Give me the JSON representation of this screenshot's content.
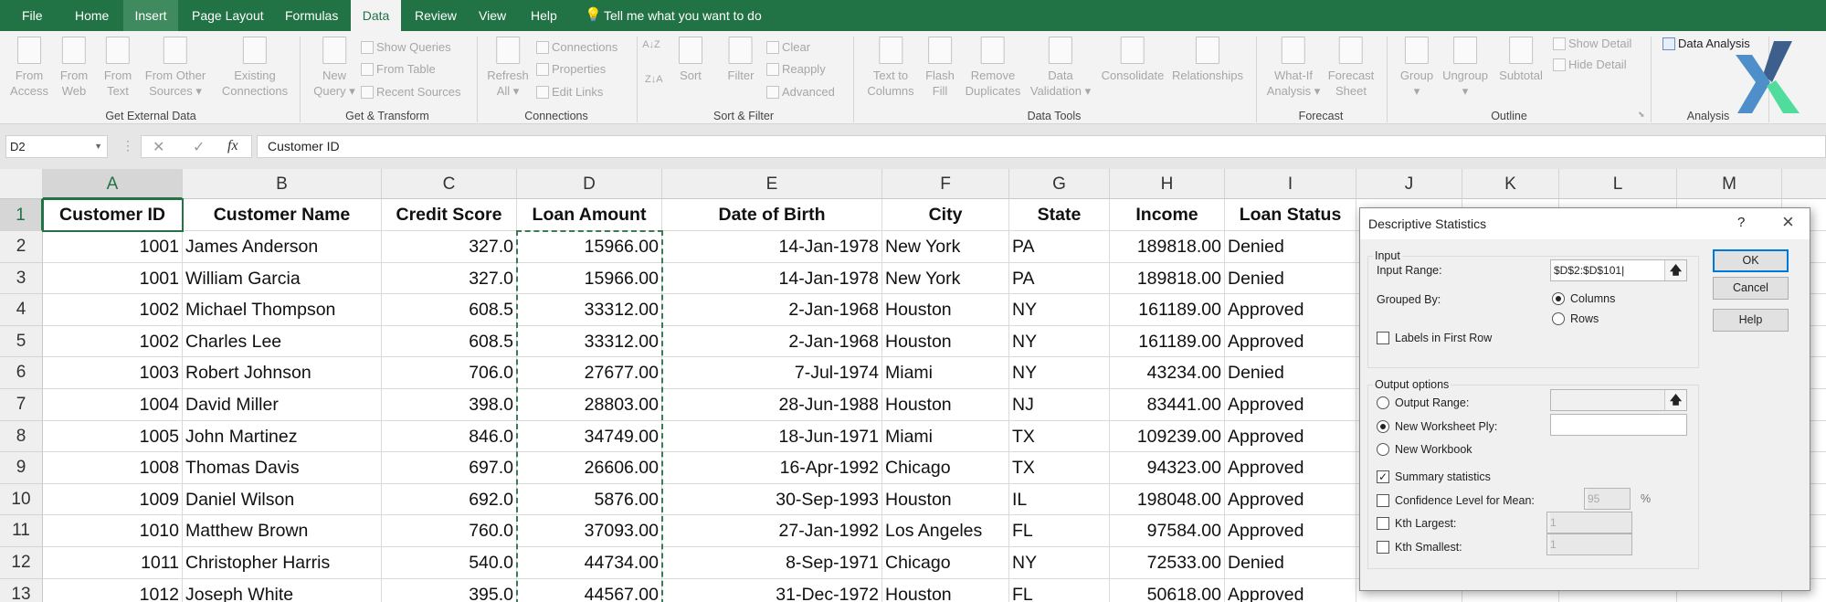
{
  "tabs": [
    {
      "label": "File"
    },
    {
      "label": "Home"
    },
    {
      "label": "Insert"
    },
    {
      "label": "Page Layout"
    },
    {
      "label": "Formulas"
    },
    {
      "label": "Data"
    },
    {
      "label": "Review"
    },
    {
      "label": "View"
    },
    {
      "label": "Help"
    }
  ],
  "tell_me": "Tell me what you want to do",
  "active_tab": "Data",
  "ribbon": {
    "large": [
      {
        "lines": [
          "From",
          "Access"
        ],
        "icon": "access-icon"
      },
      {
        "lines": [
          "From",
          "Web"
        ],
        "icon": "web-icon"
      },
      {
        "lines": [
          "From",
          "Text"
        ],
        "icon": "text-file-icon"
      },
      {
        "lines": [
          "From Other",
          "Sources ▾"
        ],
        "icon": "other-sources-icon"
      },
      {
        "lines": [
          "Existing",
          "Connections"
        ],
        "icon": "existing-connections-icon"
      },
      {
        "lines": [
          "New",
          "Query ▾"
        ],
        "icon": "new-query-icon"
      },
      {
        "lines": [
          "Refresh",
          "All ▾"
        ],
        "icon": "refresh-icon"
      },
      {
        "lines": [
          "Sort",
          ""
        ],
        "icon": "sort-icon"
      },
      {
        "lines": [
          "Filter",
          ""
        ],
        "icon": "filter-icon"
      },
      {
        "lines": [
          "Text to",
          "Columns"
        ],
        "icon": "text-to-columns-icon"
      },
      {
        "lines": [
          "Flash",
          "Fill"
        ],
        "icon": "flash-fill-icon"
      },
      {
        "lines": [
          "Remove",
          "Duplicates"
        ],
        "icon": "remove-duplicates-icon"
      },
      {
        "lines": [
          "Data",
          "Validation ▾"
        ],
        "icon": "data-validation-icon"
      },
      {
        "lines": [
          "Consolidate",
          ""
        ],
        "icon": "consolidate-icon"
      },
      {
        "lines": [
          "Relationships",
          ""
        ],
        "icon": "relationships-icon"
      },
      {
        "lines": [
          "What-If",
          "Analysis ▾"
        ],
        "icon": "what-if-icon"
      },
      {
        "lines": [
          "Forecast",
          "Sheet"
        ],
        "icon": "forecast-sheet-icon"
      },
      {
        "lines": [
          "Group",
          "▾"
        ],
        "icon": "group-icon"
      },
      {
        "lines": [
          "Ungroup",
          "▾"
        ],
        "icon": "ungroup-icon"
      },
      {
        "lines": [
          "Subtotal",
          ""
        ],
        "icon": "subtotal-icon"
      }
    ],
    "small": [
      {
        "label": "Show Queries",
        "icon": "show-queries-icon"
      },
      {
        "label": "From Table",
        "icon": "from-table-icon"
      },
      {
        "label": "Recent Sources",
        "icon": "recent-sources-icon"
      },
      {
        "label": "Connections",
        "icon": "connections-icon"
      },
      {
        "label": "Properties",
        "icon": "properties-icon"
      },
      {
        "label": "Edit Links",
        "icon": "edit-links-icon"
      },
      {
        "label": "Clear",
        "icon": "clear-filter-icon"
      },
      {
        "label": "Reapply",
        "icon": "reapply-icon"
      },
      {
        "label": "Advanced",
        "icon": "advanced-filter-icon"
      },
      {
        "label": "Show Detail",
        "icon": "show-detail-icon"
      },
      {
        "label": "Hide Detail",
        "icon": "hide-detail-icon"
      },
      {
        "label": "Data Analysis",
        "icon": "data-analysis-icon",
        "enabled": true
      }
    ],
    "groups": [
      "Get External Data",
      "Get & Transform",
      "Connections",
      "Sort & Filter",
      "Data Tools",
      "Forecast",
      "Outline",
      "Analysis"
    ]
  },
  "formula_bar": {
    "name_box": "D2",
    "formula": "Customer ID"
  },
  "sheet": {
    "columns": [
      "A",
      "B",
      "C",
      "D",
      "E",
      "F",
      "G",
      "H",
      "I",
      "J",
      "K",
      "L",
      "M"
    ],
    "header": [
      "Customer ID",
      "Customer Name",
      "Credit Score",
      "Loan Amount",
      "Date of Birth",
      "City",
      "State",
      "Income",
      "Loan Status"
    ],
    "rows": [
      [
        "1001",
        "James Anderson",
        "327.0",
        "15966.00",
        "14-Jan-1978",
        "New York",
        "PA",
        "189818.00",
        "Denied"
      ],
      [
        "1001",
        "William Garcia",
        "327.0",
        "15966.00",
        "14-Jan-1978",
        "New York",
        "PA",
        "189818.00",
        "Denied"
      ],
      [
        "1002",
        "Michael Thompson",
        "608.5",
        "33312.00",
        "2-Jan-1968",
        "Houston",
        "NY",
        "161189.00",
        "Approved"
      ],
      [
        "1002",
        "Charles Lee",
        "608.5",
        "33312.00",
        "2-Jan-1968",
        "Houston",
        "NY",
        "161189.00",
        "Approved"
      ],
      [
        "1003",
        "Robert Johnson",
        "706.0",
        "27677.00",
        "7-Jul-1974",
        "Miami",
        "NY",
        "43234.00",
        "Denied"
      ],
      [
        "1004",
        "David Miller",
        "398.0",
        "28803.00",
        "28-Jun-1988",
        "Houston",
        "NJ",
        "83441.00",
        "Approved"
      ],
      [
        "1005",
        "John Martinez",
        "846.0",
        "34749.00",
        "18-Jun-1971",
        "Miami",
        "TX",
        "109239.00",
        "Approved"
      ],
      [
        "1008",
        "Thomas Davis",
        "697.0",
        "26606.00",
        "16-Apr-1992",
        "Chicago",
        "TX",
        "94323.00",
        "Approved"
      ],
      [
        "1009",
        "Daniel Wilson",
        "692.0",
        "5876.00",
        "30-Sep-1993",
        "Houston",
        "IL",
        "198048.00",
        "Approved"
      ],
      [
        "1010",
        "Matthew Brown",
        "760.0",
        "37093.00",
        "27-Jan-1992",
        "Los Angeles",
        "FL",
        "97584.00",
        "Approved"
      ],
      [
        "1011",
        "Christopher Harris",
        "540.0",
        "44734.00",
        "8-Sep-1971",
        "Chicago",
        "NY",
        "72533.00",
        "Denied"
      ],
      [
        "1012",
        "Joseph White",
        "395.0",
        "44567.00",
        "31-Dec-1972",
        "Houston",
        "FL",
        "50618.00",
        "Approved"
      ]
    ]
  },
  "dialog": {
    "title": "Descriptive Statistics",
    "input_group": "Input",
    "input_range_label": "Input Range:",
    "input_range_value": "$D$2:$D$101",
    "grouped_by_label": "Grouped By:",
    "columns_label": "Columns",
    "rows_label": "Rows",
    "grouped_by": "Columns",
    "labels_first_row": "Labels in First Row",
    "labels_first_row_checked": false,
    "output_group": "Output options",
    "output_range": "Output Range:",
    "new_ply": "New Worksheet Ply:",
    "new_workbook": "New Workbook",
    "output_selected": "New Worksheet Ply",
    "summary": "Summary statistics",
    "summary_checked": true,
    "confidence": "Confidence Level for Mean:",
    "confidence_value": "95",
    "percent": "%",
    "kth_largest": "Kth Largest:",
    "kth_largest_value": "1",
    "kth_smallest": "Kth Smallest:",
    "kth_smallest_value": "1",
    "ok": "OK",
    "cancel": "Cancel",
    "help": "Help",
    "help_icon": "?",
    "close_icon": "×"
  },
  "colors": {
    "excel_green": "#217346",
    "selection_green": "#217346",
    "dialog_bg": "#f0f0f0",
    "default_button_border": "#0078d7"
  }
}
